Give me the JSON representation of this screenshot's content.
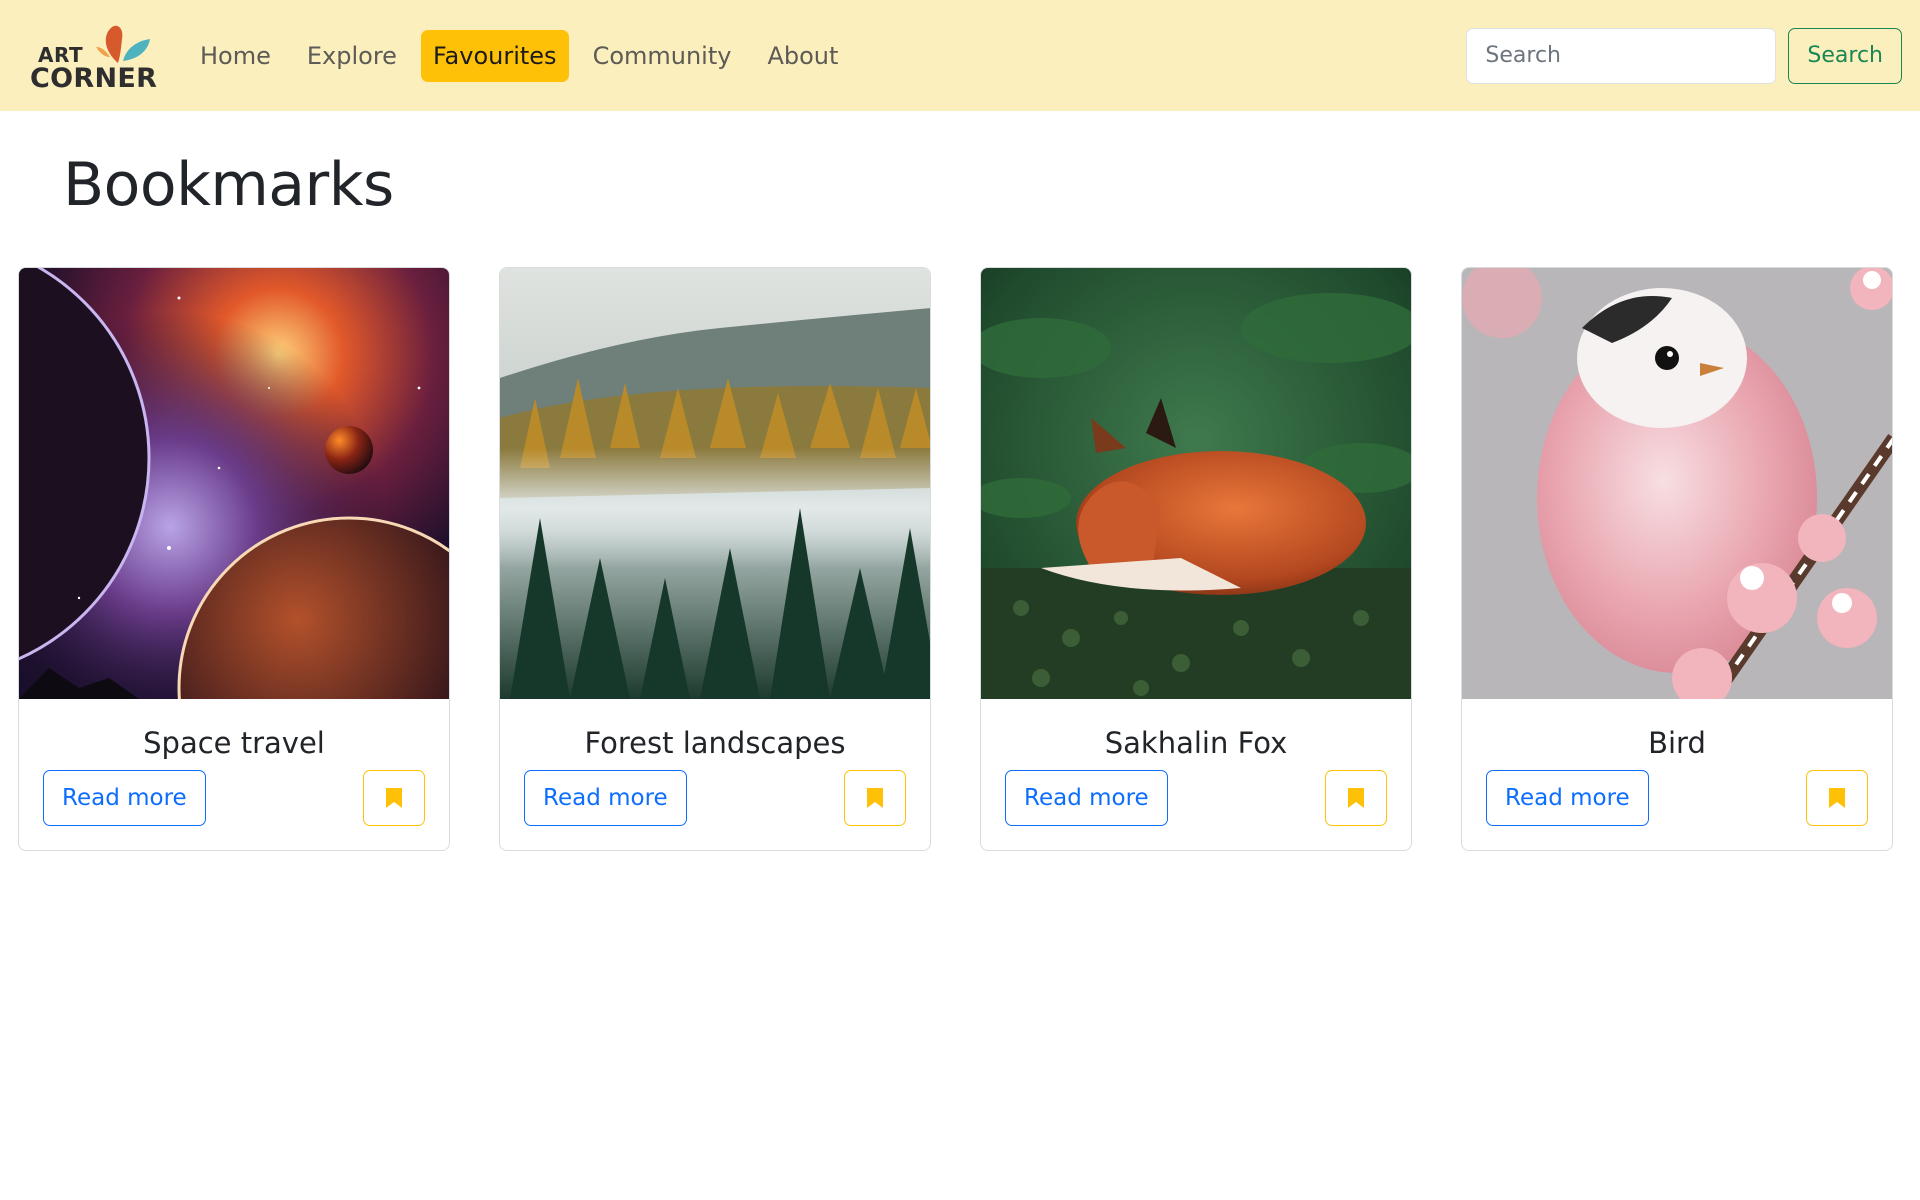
{
  "brand": {
    "line1": "ART",
    "line2": "CORNER"
  },
  "nav": {
    "items": [
      {
        "label": "Home",
        "active": false
      },
      {
        "label": "Explore",
        "active": false
      },
      {
        "label": "Favourites",
        "active": true
      },
      {
        "label": "Community",
        "active": false
      },
      {
        "label": "About",
        "active": false
      }
    ]
  },
  "search": {
    "placeholder": "Search",
    "value": "",
    "button_label": "Search"
  },
  "page": {
    "title": "Bookmarks"
  },
  "cards": [
    {
      "title": "Space travel",
      "image": "space-planets-image",
      "read_more": "Read more",
      "bookmark_icon": "bookmark-filled-icon"
    },
    {
      "title": "Forest landscapes",
      "image": "misty-forest-image",
      "read_more": "Read more",
      "bookmark_icon": "bookmark-filled-icon"
    },
    {
      "title": "Sakhalin Fox",
      "image": "sleeping-fox-image",
      "read_more": "Read more",
      "bookmark_icon": "bookmark-filled-icon"
    },
    {
      "title": "Bird",
      "image": "pink-bird-image",
      "read_more": "Read more",
      "bookmark_icon": "bookmark-filled-icon"
    }
  ],
  "colors": {
    "navbar_bg": "#fcefbe",
    "active_nav_bg": "#ffc107",
    "primary": "#0d6efd",
    "success": "#198754",
    "warning": "#ffc107"
  }
}
